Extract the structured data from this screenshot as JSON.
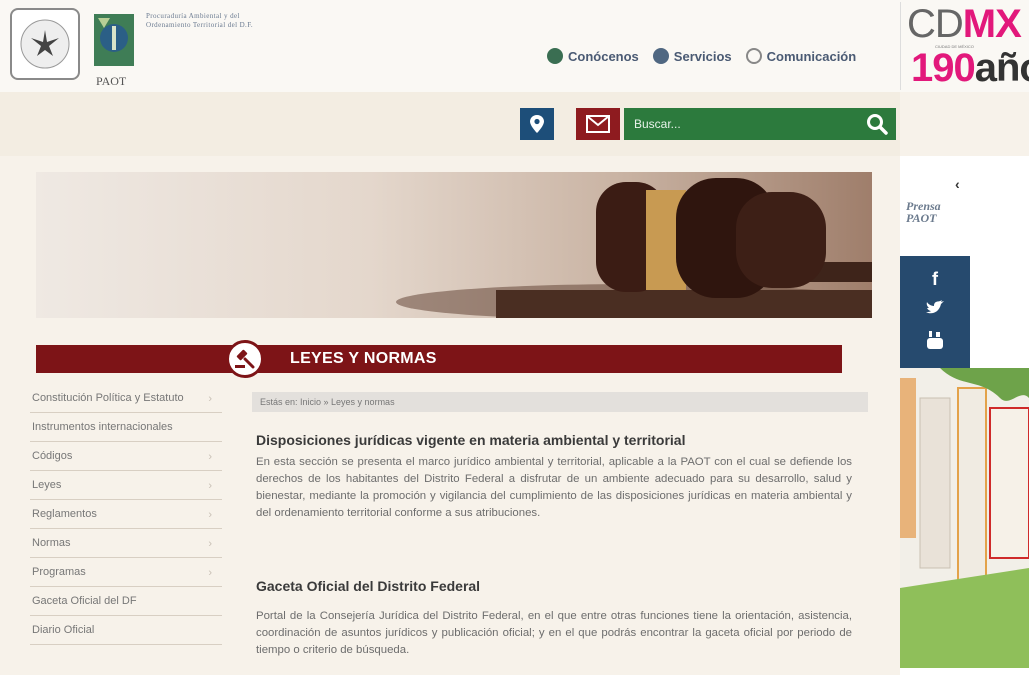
{
  "header": {
    "org_short": "PAOT",
    "org_name": "Procuraduría Ambiental y del Ordenamiento Territorial del D.F.",
    "nav": [
      {
        "label": "Conócenos",
        "icon": "tree-icon"
      },
      {
        "label": "Servicios",
        "icon": "screen-icon"
      },
      {
        "label": "Comunicación",
        "icon": "copyright-icon"
      }
    ],
    "cdmx": {
      "prefix": "CD",
      "highlight": "MX",
      "subtitle": "CIUDAD DE MÉXICO",
      "anios_num": "190",
      "anios_word": "años"
    }
  },
  "toolbar": {
    "search_placeholder": "Buscar...",
    "location_icon": "location-pin-icon",
    "mail_icon": "mail-icon",
    "search_icon": "search-icon"
  },
  "colors": {
    "maroon": "#7d1417",
    "navy": "#1d4e79",
    "green": "#2c7a3d",
    "social_blue": "#264a6e",
    "cdmx_pink": "#e2187b"
  },
  "sidebar": {
    "logo_text": "Prensa PAOT",
    "social": [
      "facebook-icon",
      "twitter-icon",
      "youtube-icon"
    ]
  },
  "section": {
    "title": "LEYES Y NORMAS"
  },
  "menu": [
    {
      "label": "Constitución Política y Estatuto"
    },
    {
      "label": "Instrumentos internacionales"
    },
    {
      "label": "Códigos"
    },
    {
      "label": "Leyes"
    },
    {
      "label": "Reglamentos"
    },
    {
      "label": "Normas"
    },
    {
      "label": "Programas"
    },
    {
      "label": "Gaceta Oficial del DF"
    },
    {
      "label": "Diario Oficial"
    }
  ],
  "breadcrumb": "Estás en: Inicio » Leyes y normas",
  "articles": [
    {
      "title": "Disposiciones jurídicas vigente en materia ambiental y territorial",
      "body": "En esta sección se presenta el marco jurídico ambiental y territorial, aplicable a la PAOT con el cual se defiende los derechos de los habitantes del Distrito Federal a disfrutar de un ambiente adecuado para su desarrollo, salud y bienestar, mediante la promoción y vigilancia del cumplimiento de las disposiciones jurídicas en materia ambiental y del ordenamiento territorial conforme a sus atribuciones."
    },
    {
      "title": "Gaceta Oficial del Distrito Federal",
      "body": "Portal de la Consejería Jurídica del Distrito Federal, en el que entre otras funciones tiene la orientación, asistencia, coordinación de asuntos jurídicos y publicación oficial; y en el que podrás encontrar la gaceta oficial por periodo de tiempo o criterio de búsqueda."
    }
  ]
}
